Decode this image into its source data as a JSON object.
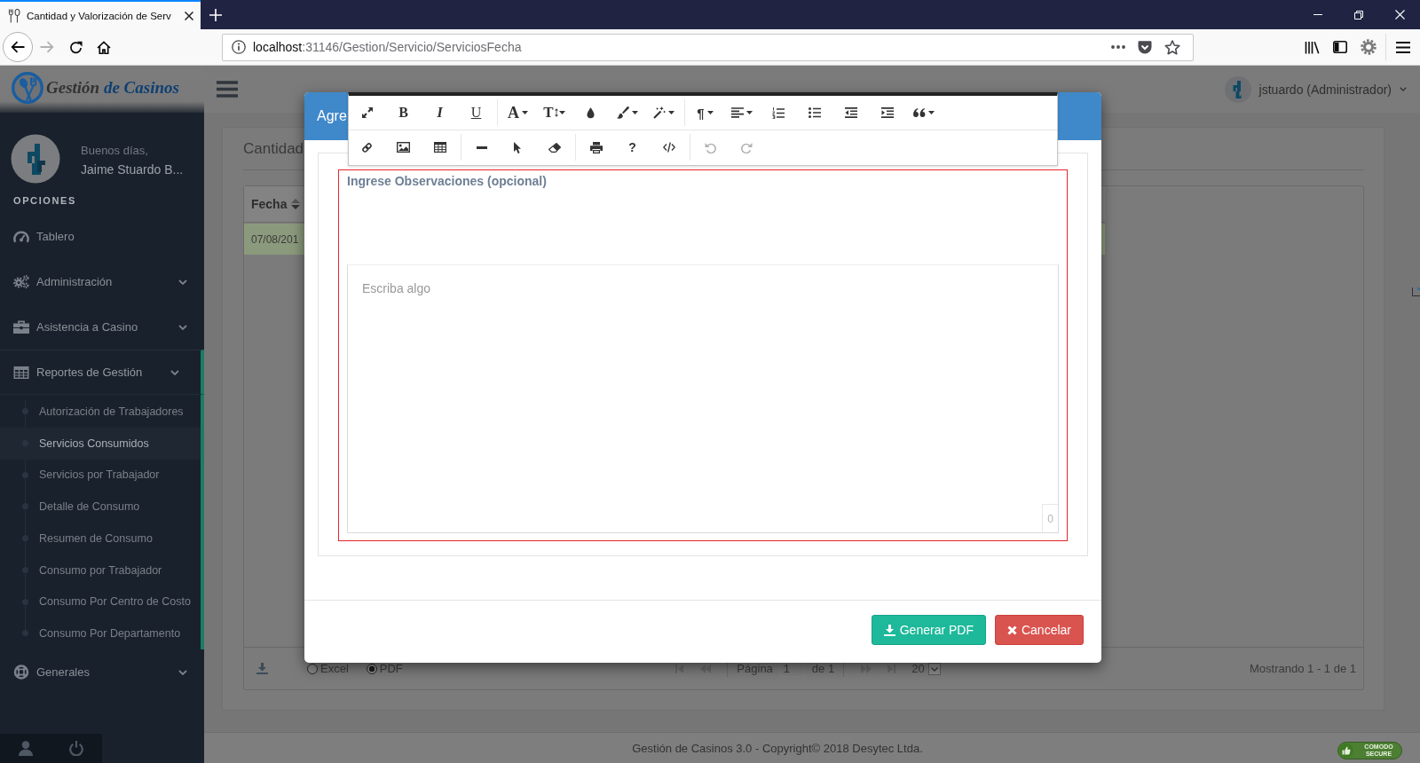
{
  "browser": {
    "tab_title": "Cantidad y Valorización de Serv",
    "url_host": "localhost",
    "url_rest": ":31146/Gestion/Servicio/ServiciosFecha",
    "forward_disabled": true
  },
  "sidebar": {
    "brand_words": [
      "Gestión",
      "de Casinos"
    ],
    "greeting": "Buenos días,",
    "user_name": "Jaime Stuardo B...",
    "section_title": "OPCIONES",
    "menu": [
      {
        "kind": "dashboard",
        "label": "Tablero",
        "has_submenu": false,
        "expanded": false
      },
      {
        "kind": "cogs",
        "label": "Administración",
        "has_submenu": true,
        "expanded": false
      },
      {
        "kind": "briefcase",
        "label": "Asistencia a Casino",
        "has_submenu": true,
        "expanded": false
      },
      {
        "kind": "grid",
        "label": "Reportes de Gestión",
        "has_submenu": true,
        "expanded": true,
        "children": [
          {
            "label": "Autorización de Trabajadores",
            "selected": false
          },
          {
            "label": "Servicios Consumidos",
            "selected": true
          },
          {
            "label": "Servicios por Trabajador",
            "selected": false
          },
          {
            "label": "Detalle de Consumo",
            "selected": false
          },
          {
            "label": "Resumen de Consumo",
            "selected": false
          },
          {
            "label": "Consumo por Trabajador",
            "selected": false
          },
          {
            "label": "Consumo Por Centro de Costo",
            "selected": false
          },
          {
            "label": "Consumo Por Departamento",
            "selected": false
          }
        ]
      },
      {
        "kind": "lifering",
        "label": "Generales",
        "has_submenu": true,
        "expanded": false
      }
    ]
  },
  "header": {
    "user": "jstuardo (Administrador)"
  },
  "content": {
    "title": "Cantidad",
    "grid": {
      "columns": [
        {
          "label": "Fecha"
        }
      ],
      "rows": [
        {
          "cells": [
            "07/08/201"
          ],
          "selected": true
        }
      ],
      "export_formats": [
        {
          "label": "Excel",
          "selected": false
        },
        {
          "label": "PDF",
          "selected": true
        }
      ],
      "nav_buttons": [
        {
          "kind": "first",
          "disabled": true
        },
        {
          "kind": "prev",
          "disabled": true
        },
        {
          "kind": "next",
          "disabled": true
        },
        {
          "kind": "last",
          "disabled": true
        }
      ],
      "pager": {
        "page_label": "Página",
        "page": "1",
        "of_label": "de 1",
        "page_size": "20",
        "summary": "Mostrando 1 - 1 de 1"
      }
    }
  },
  "footer": {
    "copyright": "Gestión de Casinos 3.0 - Copyright© 2018 Desytec Ltda.",
    "badge_lines": [
      "COMODO",
      "SECURE"
    ]
  },
  "modal": {
    "title": "Agre",
    "field_label": "Ingrese Observaciones (opcional)",
    "editor": {
      "placeholder": "Escriba algo",
      "counter": "0",
      "toolbar": [
        [
          [
            {
              "kind": "fullscreen",
              "dropdown": false,
              "disabled": false
            },
            {
              "kind": "bold",
              "label": "B",
              "dropdown": false,
              "disabled": false
            },
            {
              "kind": "italic",
              "label": "I",
              "dropdown": false,
              "disabled": false
            },
            {
              "kind": "underline",
              "label": "U",
              "dropdown": false,
              "disabled": false
            }
          ],
          [
            {
              "kind": "font",
              "label": "A",
              "dropdown": true,
              "disabled": false
            },
            {
              "kind": "fontsize",
              "label": "T",
              "dropdown": true,
              "disabled": false
            },
            {
              "kind": "color",
              "dropdown": false,
              "disabled": false
            },
            {
              "kind": "brush",
              "dropdown": true,
              "disabled": false
            },
            {
              "kind": "magic",
              "dropdown": true,
              "disabled": false
            }
          ],
          [
            {
              "kind": "paragraph",
              "label": "¶",
              "dropdown": true,
              "disabled": false
            },
            {
              "kind": "align",
              "dropdown": true,
              "disabled": false
            },
            {
              "kind": "ol",
              "dropdown": false,
              "disabled": false
            },
            {
              "kind": "ul",
              "dropdown": false,
              "disabled": false
            },
            {
              "kind": "outdent",
              "dropdown": false,
              "disabled": false
            },
            {
              "kind": "indent",
              "dropdown": false,
              "disabled": false
            },
            {
              "kind": "quote",
              "dropdown": true,
              "disabled": false
            }
          ]
        ],
        [
          [
            {
              "kind": "link",
              "dropdown": false,
              "disabled": false
            },
            {
              "kind": "picture",
              "dropdown": false,
              "disabled": false
            },
            {
              "kind": "table",
              "dropdown": false,
              "disabled": false
            }
          ],
          [
            {
              "kind": "hr",
              "dropdown": false,
              "disabled": false
            },
            {
              "kind": "pointer",
              "dropdown": false,
              "disabled": false
            },
            {
              "kind": "eraser",
              "dropdown": false,
              "disabled": false
            }
          ],
          [
            {
              "kind": "print",
              "dropdown": false,
              "disabled": false
            },
            {
              "kind": "help",
              "label": "?",
              "dropdown": false,
              "disabled": false
            },
            {
              "kind": "code",
              "dropdown": false,
              "disabled": false
            }
          ],
          [
            {
              "kind": "undo",
              "dropdown": false,
              "disabled": true
            },
            {
              "kind": "redo",
              "dropdown": false,
              "disabled": true
            }
          ]
        ]
      ]
    },
    "buttons": [
      {
        "kind": "primary",
        "label": "Generar PDF"
      },
      {
        "kind": "danger",
        "label": "Cancelar"
      }
    ]
  }
}
